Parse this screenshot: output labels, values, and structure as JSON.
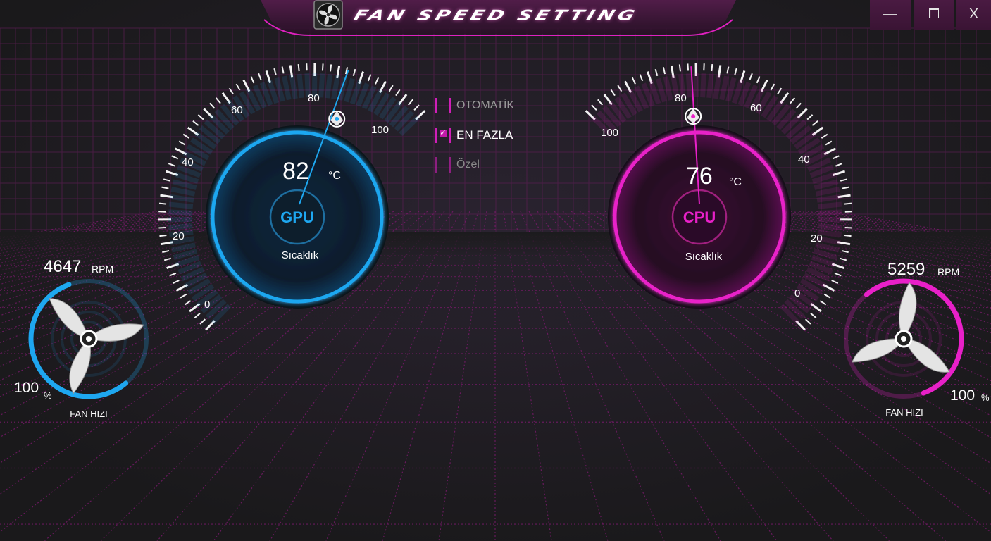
{
  "title": "FAN SPEED SETTING",
  "window_controls": {
    "minimize": "—",
    "maximize": "⧠",
    "close": "X"
  },
  "icons": {
    "title": "fan-icon",
    "minimize": "minimize-icon",
    "maximize": "maximize-icon",
    "close": "close-icon"
  },
  "colors": {
    "gpu_accent": "#1ea7f0",
    "cpu_accent": "#e820c8",
    "background": "#1c1b1d",
    "title_bar": "#4a1a42"
  },
  "gpu": {
    "label": "GPU",
    "temperature": "82",
    "temperature_unit": "°C",
    "sublabel": "Sıcaklık",
    "gauge_ticks": [
      "0",
      "20",
      "40",
      "60",
      "80",
      "100"
    ],
    "needle_value": 82,
    "fan": {
      "rpm": "4647",
      "rpm_unit": "RPM",
      "percent": "100",
      "percent_unit": "%",
      "label": "FAN HIZI",
      "level": 1.0
    }
  },
  "cpu": {
    "label": "CPU",
    "temperature": "76",
    "temperature_unit": "°C",
    "sublabel": "Sıcaklık",
    "gauge_ticks": [
      "0",
      "20",
      "40",
      "60",
      "80",
      "100"
    ],
    "needle_value": 76,
    "fan": {
      "rpm": "5259",
      "rpm_unit": "RPM",
      "percent": "100",
      "percent_unit": "%",
      "label": "FAN HIZI",
      "level": 1.0
    }
  },
  "modes": [
    {
      "label": "OTOMATİK",
      "checked": false
    },
    {
      "label": "EN FAZLA",
      "checked": true
    },
    {
      "label": "Özel",
      "checked": false
    }
  ]
}
